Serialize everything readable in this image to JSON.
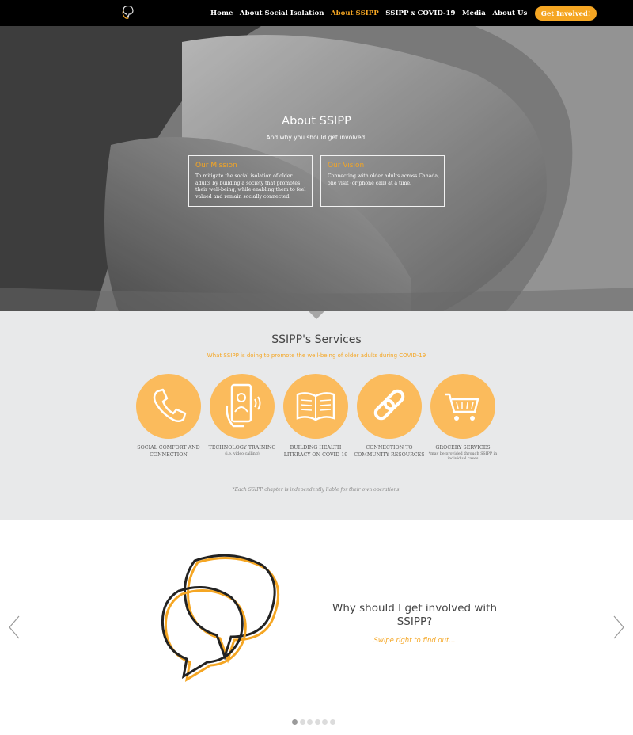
{
  "nav": {
    "items": [
      {
        "label": "Home",
        "active": false
      },
      {
        "label": "About Social Isolation",
        "active": false
      },
      {
        "label": "About SSIPP",
        "active": true
      },
      {
        "label": "SSIPP x COVID-19",
        "active": false
      },
      {
        "label": "Media",
        "active": false
      },
      {
        "label": "About Us",
        "active": false
      }
    ],
    "cta_label": "Get Involved!"
  },
  "hero": {
    "title": "About SSIPP",
    "subtitle": "And why you should get involved.",
    "mission": {
      "heading": "Our Mission",
      "text": "To mitigate the social isolation of older adults by building a society that promotes their well-being, while enabling them to feel valued and remain socially connected."
    },
    "vision": {
      "heading": "Our Vision",
      "text": "Connecting with older adults across Canada, one visit (or phone call) at a time."
    }
  },
  "services": {
    "title": "SSIPP's Services",
    "subtitle": "What SSIPP is doing to promote the well-being of older adults during COVID-19",
    "items": [
      {
        "icon": "phone-icon",
        "label": "SOCIAL COMFORT AND CONNECTION",
        "note": ""
      },
      {
        "icon": "video-call-icon",
        "label": "TECHNOLOGY TRAINING",
        "note": "(i.e. video calling)"
      },
      {
        "icon": "book-icon",
        "label": "BUILDING HEALTH LITERACY ON COVID-19",
        "note": ""
      },
      {
        "icon": "link-icon",
        "label": "CONNECTION TO COMMUNITY RESOURCES",
        "note": ""
      },
      {
        "icon": "shopping-cart-icon",
        "label": "GROCERY SERVICES",
        "note": "*may be provided through SSIPP in individual cases"
      }
    ],
    "disclaimer": "*Each SSIPP chapter is independently liable for their own operations."
  },
  "carousel": {
    "heading": "Why should I get involved with SSIPP?",
    "subheading": "Swipe right to find out...",
    "slide_count": 6,
    "active_slide": 1
  },
  "colors": {
    "accent": "#f5a623",
    "circle": "#fbbb5c",
    "nav_bg": "#000000",
    "services_bg": "#e8e9ea"
  }
}
